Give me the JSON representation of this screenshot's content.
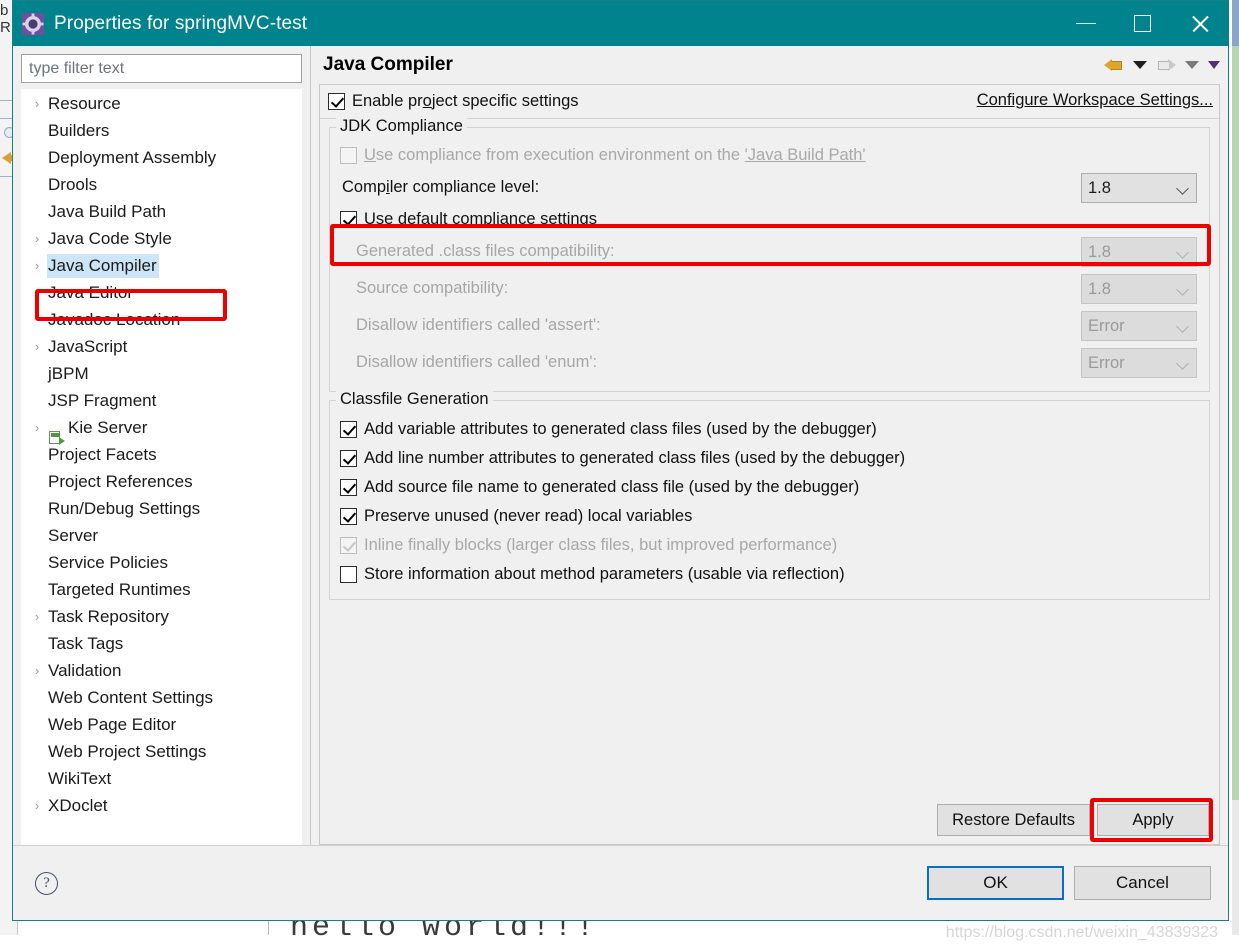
{
  "window": {
    "title": "Properties for springMVC-test",
    "icon": "gear-icon",
    "minimize_label": "Minimize",
    "maximize_label": "Maximize",
    "close_label": "Close"
  },
  "sidebar": {
    "filter_placeholder": "type filter text",
    "filter_value": "",
    "items": [
      {
        "label": "Resource",
        "expandable": true,
        "icon": null,
        "selected": false
      },
      {
        "label": "Builders",
        "expandable": false,
        "icon": null,
        "selected": false
      },
      {
        "label": "Deployment Assembly",
        "expandable": false,
        "icon": null,
        "selected": false
      },
      {
        "label": "Drools",
        "expandable": false,
        "icon": null,
        "selected": false
      },
      {
        "label": "Java Build Path",
        "expandable": false,
        "icon": null,
        "selected": false
      },
      {
        "label": "Java Code Style",
        "expandable": true,
        "icon": null,
        "selected": false
      },
      {
        "label": "Java Compiler",
        "expandable": true,
        "icon": null,
        "selected": true
      },
      {
        "label": "Java Editor",
        "expandable": true,
        "icon": null,
        "selected": false
      },
      {
        "label": "Javadoc Location",
        "expandable": false,
        "icon": null,
        "selected": false
      },
      {
        "label": "JavaScript",
        "expandable": true,
        "icon": null,
        "selected": false
      },
      {
        "label": "jBPM",
        "expandable": false,
        "icon": null,
        "selected": false
      },
      {
        "label": "JSP Fragment",
        "expandable": false,
        "icon": null,
        "selected": false
      },
      {
        "label": "Kie Server",
        "expandable": true,
        "icon": "server-icon",
        "selected": false
      },
      {
        "label": "Project Facets",
        "expandable": false,
        "icon": null,
        "selected": false
      },
      {
        "label": "Project References",
        "expandable": false,
        "icon": null,
        "selected": false
      },
      {
        "label": "Run/Debug Settings",
        "expandable": false,
        "icon": null,
        "selected": false
      },
      {
        "label": "Server",
        "expandable": false,
        "icon": null,
        "selected": false
      },
      {
        "label": "Service Policies",
        "expandable": false,
        "icon": null,
        "selected": false
      },
      {
        "label": "Targeted Runtimes",
        "expandable": false,
        "icon": null,
        "selected": false
      },
      {
        "label": "Task Repository",
        "expandable": true,
        "icon": null,
        "selected": false
      },
      {
        "label": "Task Tags",
        "expandable": false,
        "icon": null,
        "selected": false
      },
      {
        "label": "Validation",
        "expandable": true,
        "icon": null,
        "selected": false
      },
      {
        "label": "Web Content Settings",
        "expandable": false,
        "icon": null,
        "selected": false
      },
      {
        "label": "Web Page Editor",
        "expandable": false,
        "icon": null,
        "selected": false
      },
      {
        "label": "Web Project Settings",
        "expandable": false,
        "icon": null,
        "selected": false
      },
      {
        "label": "WikiText",
        "expandable": false,
        "icon": null,
        "selected": false
      },
      {
        "label": "XDoclet",
        "expandable": true,
        "icon": null,
        "selected": false
      }
    ]
  },
  "page": {
    "title": "Java Compiler",
    "nav": {
      "back_icon": "arrow-left-icon",
      "back_menu_icon": "chevron-down-icon",
      "forward_icon": "arrow-right-icon",
      "forward_menu_icon": "chevron-down-icon",
      "more_menu_icon": "chevron-down-icon"
    },
    "enable_project_specific": {
      "label": "Enable project specific settings",
      "checked": true
    },
    "configure_workspace_link": "Configure Workspace Settings...",
    "jdk_compliance": {
      "legend": "JDK Compliance",
      "use_execution_env": {
        "label_before": "Use compliance from execution environment on the ",
        "label_link": "'Java Build Path'",
        "checked": false,
        "enabled": false
      },
      "compiler_compliance_level": {
        "label": "Compiler compliance level:",
        "value": "1.8",
        "enabled": true,
        "highlighted": true
      },
      "use_default_compliance": {
        "label": "Use default compliance settings",
        "checked": true,
        "enabled": true
      },
      "rows": [
        {
          "label": "Generated .class files compatibility:",
          "value": "1.8",
          "enabled": false
        },
        {
          "label": "Source compatibility:",
          "value": "1.8",
          "enabled": false
        },
        {
          "label": "Disallow identifiers called 'assert':",
          "value": "Error",
          "enabled": false
        },
        {
          "label": "Disallow identifiers called 'enum':",
          "value": "Error",
          "enabled": false
        }
      ]
    },
    "classfile_generation": {
      "legend": "Classfile Generation",
      "items": [
        {
          "label": "Add variable attributes to generated class files (used by the debugger)",
          "checked": true,
          "enabled": true
        },
        {
          "label": "Add line number attributes to generated class files (used by the debugger)",
          "checked": true,
          "enabled": true
        },
        {
          "label": "Add source file name to generated class file (used by the debugger)",
          "checked": true,
          "enabled": true
        },
        {
          "label": "Preserve unused (never read) local variables",
          "checked": true,
          "enabled": true
        },
        {
          "label": "Inline finally blocks (larger class files, but improved performance)",
          "checked": true,
          "enabled": false
        },
        {
          "label": "Store information about method parameters (usable via reflection)",
          "checked": false,
          "enabled": true
        }
      ]
    },
    "actions": {
      "restore_defaults": "Restore Defaults",
      "apply": "Apply",
      "apply_highlighted": true
    }
  },
  "footer": {
    "help_icon": "question-mark-icon",
    "ok": "OK",
    "cancel": "Cancel",
    "watermark": "https://blog.csdn.net/weixin_43839323"
  },
  "background": {
    "left_tab_text": "b R",
    "editor_text": "hello world!!!"
  },
  "colors": {
    "titlebar": "#00838c",
    "highlight": "#ee0000",
    "selection": "#cde6f7",
    "focus_border": "#0a6fc2",
    "dialog_bg": "#f0f0f0"
  }
}
